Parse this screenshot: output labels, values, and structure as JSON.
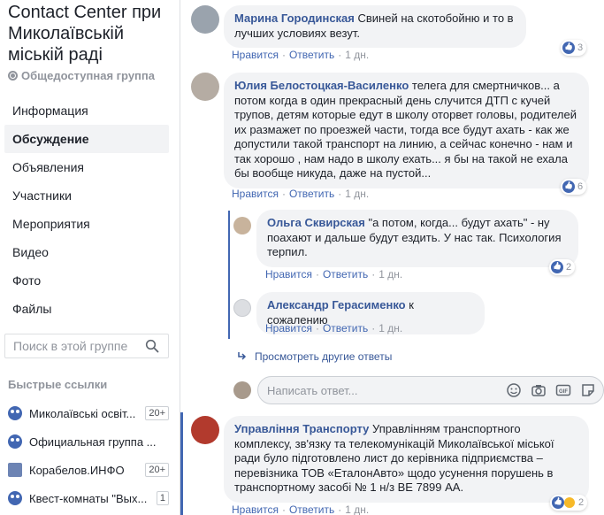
{
  "group": {
    "title": "Contact Center при Миколаївській міській раді",
    "privacy": "Общедоступная группа"
  },
  "nav": {
    "items": [
      {
        "label": "Информация"
      },
      {
        "label": "Обсуждение"
      },
      {
        "label": "Объявления"
      },
      {
        "label": "Участники"
      },
      {
        "label": "Мероприятия"
      },
      {
        "label": "Видео"
      },
      {
        "label": "Фото"
      },
      {
        "label": "Файлы"
      }
    ],
    "active_index": 1
  },
  "search": {
    "placeholder": "Поиск в этой группе"
  },
  "quick_links": {
    "title": "Быстрые ссылки",
    "items": [
      {
        "label": "Миколаївські освіт...",
        "badge": "20+"
      },
      {
        "label": "Официальная группа ..."
      },
      {
        "label": "Корабелов.ИНФО",
        "badge": "20+"
      },
      {
        "label": "Квест-комнаты \"Вых...",
        "badge": "1"
      }
    ]
  },
  "comments": [
    {
      "author": "Марина Городинская",
      "text": "Свиней на скотобойню и то в лучших условиях везут.",
      "like": "Нравится",
      "reply": "Ответить",
      "time": "1 дн.",
      "reactions": "3"
    },
    {
      "author": "Юлия Белостоцкая-Василенко",
      "text": "телега для смертничков... а потом когда в один прекрасный день случится ДТП с кучей трупов, детям которые едут в школу оторвет головы, родителей их размажет по проезжей части, тогда все будут ахать - как же допустили такой транспорт на линию, а сейчас конечно - нам и так хорошо , нам надо в школу ехать... я бы на такой не ехала бы вообще никуда, даже на пустой...",
      "like": "Нравится",
      "reply": "Ответить",
      "time": "1 дн.",
      "reactions": "6"
    },
    {
      "author": "Ольга Сквирская",
      "text": "\"а потом, когда... будут ахать\" - ну поахают и дальше будут ездить. У нас так. Психология терпил.",
      "like": "Нравится",
      "reply": "Ответить",
      "time": "1 дн.",
      "reactions": "2"
    },
    {
      "author": "Александр Герасименко",
      "text": "к сожалению",
      "like": "Нравится",
      "reply": "Ответить",
      "time": "1 дн."
    },
    {
      "author": "Управління Транспорту",
      "text": "Управлінням транспортного комплексу, зв'язку та телекомунікацій Миколаївської міської ради було підготовлено лист до керівника підприємства – перевізника ТОВ «ЕталонАвто» щодо усунення порушень в транспортному засобі № 1 н/з ВЕ 7899 АА.",
      "like": "Нравится",
      "reply": "Ответить",
      "time": "1 дн.",
      "reactions": "2"
    }
  ],
  "view_more_replies": "Просмотреть другие ответы",
  "reply_box": {
    "placeholder": "Написать ответ..."
  },
  "colors": {
    "accent": "#4267b2",
    "link": "#385898",
    "bubble": "#f2f3f5",
    "muted": "#90949c"
  }
}
